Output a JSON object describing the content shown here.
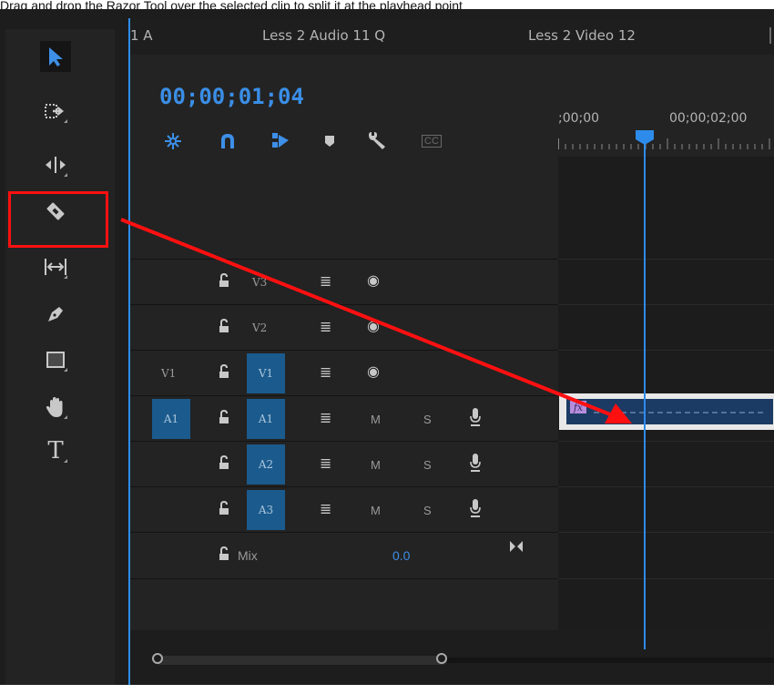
{
  "caption": "Drag and drop the Razor Tool over the selected clip to split it at the playhead point",
  "tabs": [
    "1 A",
    "Less 2 Audio 11 Q",
    "Less 2 Video 12"
  ],
  "timecode": "00;00;01;04",
  "ruler": {
    "labels": [
      ";00;00",
      "00;00;02;00"
    ]
  },
  "controls": [
    "snap-icon",
    "magnet-icon",
    "linked-selection-icon",
    "marker-icon",
    "wrench-icon",
    "closed-captions-icon"
  ],
  "closed_captions_label": "CC",
  "tools": [
    "selection-tool",
    "track-select-tool",
    "ripple-edit-tool",
    "razor-tool",
    "slip-tool",
    "pen-tool",
    "rectangle-tool",
    "hand-tool",
    "type-tool"
  ],
  "type_tool_label": "T",
  "tracks": {
    "video": [
      {
        "name": "V3",
        "source": ""
      },
      {
        "name": "V2",
        "source": ""
      },
      {
        "name": "V1",
        "source": "V1"
      }
    ],
    "audio": [
      {
        "name": "A1",
        "source": "A1",
        "m": "M",
        "s": "S"
      },
      {
        "name": "A2",
        "source": "",
        "m": "M",
        "s": "S"
      },
      {
        "name": "A3",
        "source": "",
        "m": "M",
        "s": "S"
      }
    ],
    "mix": {
      "label": "Mix",
      "value": "0.0"
    }
  },
  "clip": {
    "fx_label": "fx"
  },
  "colors": {
    "accent": "#2d8ceb",
    "highlight_box": "#ff1010",
    "track_selected": "#1b5a8c",
    "clip_fx": "#b68ddd"
  }
}
